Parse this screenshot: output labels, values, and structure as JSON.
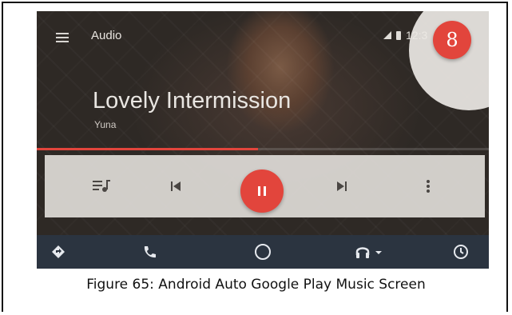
{
  "figure": {
    "caption": "Figure 65: Android Auto Google Play Music Screen"
  },
  "header": {
    "app_title": "Audio",
    "clock": "12:3",
    "voice_button_label": "8"
  },
  "now_playing": {
    "title": "Lovely Intermission",
    "artist": "Yuna",
    "progress_fraction": 0.49
  },
  "controls": {
    "queue_icon": "queue-music-icon",
    "previous_icon": "skip-previous-icon",
    "play_pause_icon": "pause-icon",
    "next_icon": "skip-next-icon",
    "more_icon": "more-vertical-icon"
  },
  "nav": {
    "items": [
      "navigation-icon",
      "phone-icon",
      "home-icon",
      "headphones-icon",
      "recents-icon"
    ]
  },
  "colors": {
    "accent": "#e2453c",
    "navbar": "#2b3440",
    "controls_bg": "#dedad6"
  }
}
